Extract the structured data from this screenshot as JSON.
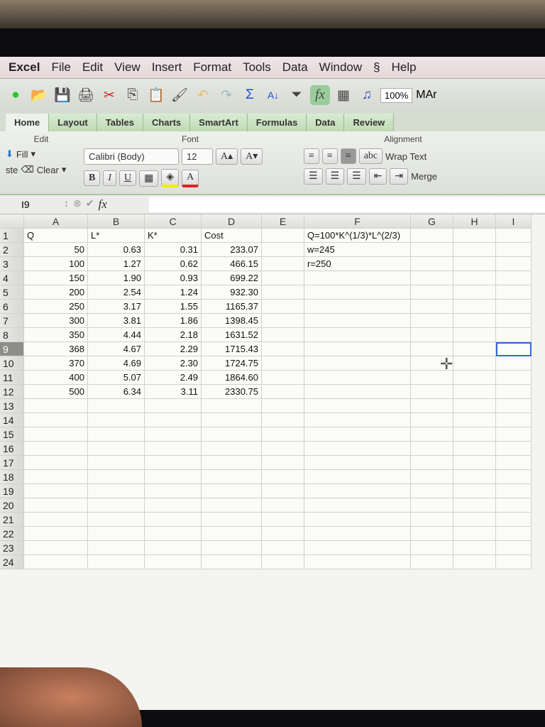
{
  "menubar": {
    "app": "Excel",
    "items": [
      "File",
      "Edit",
      "View",
      "Insert",
      "Format",
      "Tools",
      "Data",
      "Window",
      "Help"
    ]
  },
  "toolbar": {
    "zoom": "100%",
    "doc_name": "MAr"
  },
  "tabs": [
    "Home",
    "Layout",
    "Tables",
    "Charts",
    "SmartArt",
    "Formulas",
    "Data",
    "Review"
  ],
  "ribbon": {
    "edit_group": "Edit",
    "fill": "Fill",
    "clear": "Clear",
    "paste_partial": "ste",
    "font_group": "Font",
    "font_name": "Calibri (Body)",
    "font_size": "12",
    "bold": "B",
    "italic": "I",
    "underline": "U",
    "grow": "A▴",
    "shrink": "A▾",
    "font_color": "A",
    "alignment_group": "Alignment",
    "abc": "abc",
    "wrap_text": "Wrap Text",
    "merge": "Merge"
  },
  "formula_bar": {
    "name_box": "I9",
    "fx": "fx",
    "value": ""
  },
  "sheet": {
    "columns": [
      "A",
      "B",
      "C",
      "D",
      "E",
      "F",
      "G",
      "H",
      "I"
    ],
    "selected_cell": "I9",
    "rows": [
      [
        "Q",
        "L*",
        "K*",
        "Cost",
        "",
        "Q=100*K^(1/3)*L^(2/3)",
        "",
        "",
        ""
      ],
      [
        "50",
        "0.63",
        "0.31",
        "233.07",
        "",
        "w=245",
        "",
        "",
        ""
      ],
      [
        "100",
        "1.27",
        "0.62",
        "466.15",
        "",
        "r=250",
        "",
        "",
        ""
      ],
      [
        "150",
        "1.90",
        "0.93",
        "699.22",
        "",
        "",
        "",
        "",
        ""
      ],
      [
        "200",
        "2.54",
        "1.24",
        "932.30",
        "",
        "",
        "",
        "",
        ""
      ],
      [
        "250",
        "3.17",
        "1.55",
        "1165.37",
        "",
        "",
        "",
        "",
        ""
      ],
      [
        "300",
        "3.81",
        "1.86",
        "1398.45",
        "",
        "",
        "",
        "",
        ""
      ],
      [
        "350",
        "4.44",
        "2.18",
        "1631.52",
        "",
        "",
        "",
        "",
        ""
      ],
      [
        "368",
        "4.67",
        "2.29",
        "1715.43",
        "",
        "",
        "",
        "",
        ""
      ],
      [
        "370",
        "4.69",
        "2.30",
        "1724.75",
        "",
        "",
        "",
        "",
        ""
      ],
      [
        "400",
        "5.07",
        "2.49",
        "1864.60",
        "",
        "",
        "",
        "",
        ""
      ],
      [
        "500",
        "6.34",
        "3.11",
        "2330.75",
        "",
        "",
        "",
        "",
        ""
      ],
      [
        "",
        "",
        "",
        "",
        "",
        "",
        "",
        "",
        ""
      ],
      [
        "",
        "",
        "",
        "",
        "",
        "",
        "",
        "",
        ""
      ],
      [
        "",
        "",
        "",
        "",
        "",
        "",
        "",
        "",
        ""
      ],
      [
        "",
        "",
        "",
        "",
        "",
        "",
        "",
        "",
        ""
      ],
      [
        "",
        "",
        "",
        "",
        "",
        "",
        "",
        "",
        ""
      ],
      [
        "",
        "",
        "",
        "",
        "",
        "",
        "",
        "",
        ""
      ],
      [
        "",
        "",
        "",
        "",
        "",
        "",
        "",
        "",
        ""
      ],
      [
        "",
        "",
        "",
        "",
        "",
        "",
        "",
        "",
        ""
      ],
      [
        "",
        "",
        "",
        "",
        "",
        "",
        "",
        "",
        ""
      ],
      [
        "",
        "",
        "",
        "",
        "",
        "",
        "",
        "",
        ""
      ],
      [
        "",
        "",
        "",
        "",
        "",
        "",
        "",
        "",
        ""
      ],
      [
        "",
        "",
        "",
        "",
        "",
        "",
        "",
        "",
        ""
      ]
    ]
  }
}
